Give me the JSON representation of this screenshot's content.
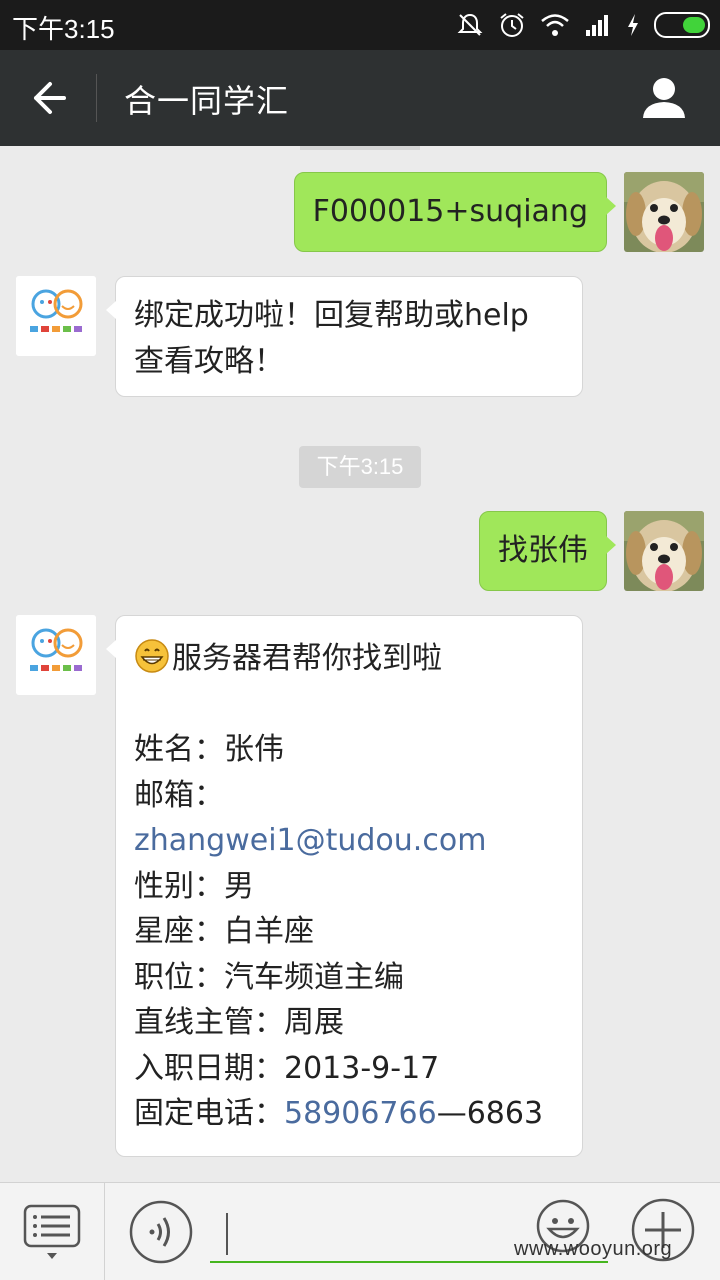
{
  "status_bar": {
    "time": "下午3:15",
    "icons": [
      "mute-icon",
      "alarm-icon",
      "wifi-icon",
      "signal-icon",
      "charging-icon",
      "battery-icon"
    ],
    "battery_color": "#41d33a"
  },
  "header": {
    "title": "合一同学汇",
    "back_icon": "back-arrow-icon",
    "profile_icon": "person-icon",
    "background": "#2e3132"
  },
  "messages": [
    {
      "direction": "out",
      "text": "F000015+suqiang",
      "avatar": "dog-avatar"
    },
    {
      "direction": "in",
      "lines": [
        "绑定成功啦！回复帮助或help",
        "查看攻略！"
      ],
      "avatar": "logo-avatar"
    },
    {
      "type": "timestamp",
      "text": "下午3:15"
    },
    {
      "direction": "out",
      "text": "找张伟",
      "avatar": "dog-avatar"
    },
    {
      "direction": "in",
      "avatar": "logo-avatar",
      "headline": "服务器君帮你找到啦",
      "fields": {
        "name": "姓名：张伟",
        "email_label": "邮箱：",
        "email": "zhangwei1@tudou.com",
        "gender": "性别：男",
        "zodiac": "星座：白羊座",
        "position": "职位：汽车频道主编",
        "manager": "直线主管：周展",
        "join_date": "入职日期：2013-9-17",
        "phone_label": "固定电话：",
        "phone_number": "58906766",
        "phone_ext": "—6863"
      }
    }
  ],
  "bottom_bar": {
    "menu_icon": "menu-list-icon",
    "voice_icon": "voice-icon",
    "input_value": "",
    "emoji_icon": "emoji-icon",
    "plus_icon": "plus-icon"
  },
  "watermark": "www.wooyun.org",
  "colors": {
    "outgoing_bubble": "#a0e75a",
    "incoming_bubble": "#ffffff",
    "link": "#4a6b9e",
    "chat_background": "#ebebeb"
  }
}
